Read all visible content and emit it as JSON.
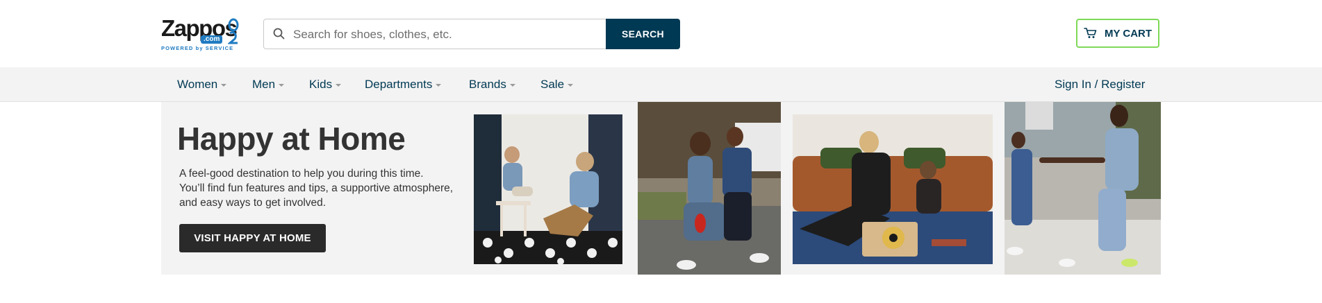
{
  "header": {
    "logo": {
      "word": "Zappos",
      "com": ".com",
      "tagline": "POWERED by SERVICE"
    },
    "search": {
      "placeholder": "Search for shoes, clothes, etc.",
      "value": "",
      "button_label": "SEARCH"
    },
    "cart": {
      "label": "MY CART"
    }
  },
  "nav": {
    "items": [
      {
        "label": "Women"
      },
      {
        "label": "Men"
      },
      {
        "label": "Kids"
      },
      {
        "label": "Departments"
      },
      {
        "label": "Brands"
      },
      {
        "label": "Sale"
      }
    ],
    "signin_label": "Sign In / Register"
  },
  "hero": {
    "title": "Happy at Home",
    "description_lines": [
      "A feel-good destination to help you during this time.",
      "You’ll find fun features and tips, a supportive atmosphere,",
      "and easy ways to get involved."
    ],
    "button_label": "VISIT HAPPY AT HOME"
  },
  "colors": {
    "brand_navy": "#003953",
    "cart_border": "#7ed957",
    "logo_blue": "#1f7bc1",
    "hero_bg": "#f3f3f3",
    "hero_button": "#2a2a2a"
  }
}
